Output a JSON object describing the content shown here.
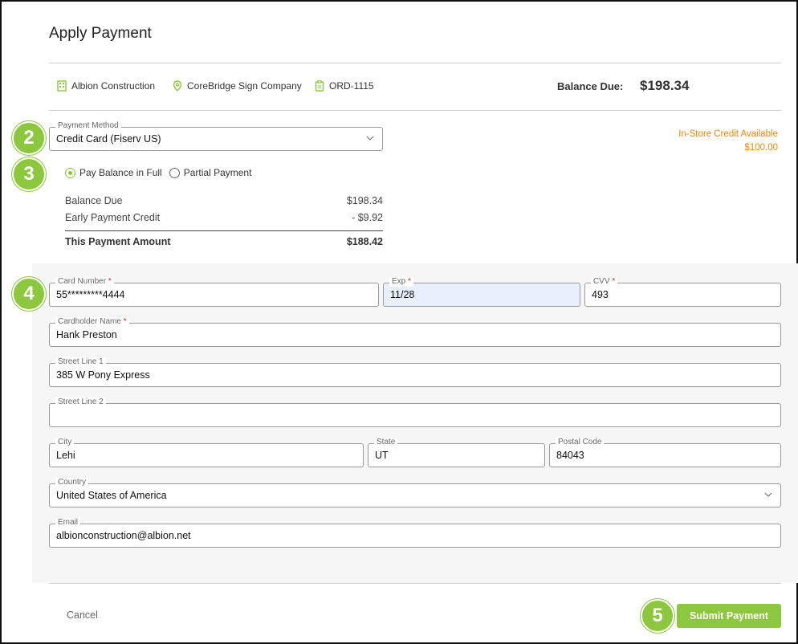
{
  "dialog": {
    "title": "Apply Payment"
  },
  "context": {
    "company": "Albion Construction",
    "location": "CoreBridge Sign Company",
    "order": "ORD-1115",
    "balance_due_label": "Balance Due:",
    "balance_due_value": "$198.34"
  },
  "steps": [
    "2",
    "3",
    "4",
    "5"
  ],
  "payment_method": {
    "label": "Payment Method",
    "value": "Credit Card (Fiserv US)"
  },
  "store_credit": {
    "label": "In-Store Credit Available",
    "amount": "$100.00"
  },
  "payment_options": {
    "full_label": "Pay Balance in Full",
    "partial_label": "Partial Payment",
    "selected": "full"
  },
  "summary": {
    "balance_due_label": "Balance Due",
    "balance_due_value": "$198.34",
    "early_credit_label": "Early Payment Credit",
    "early_credit_value": "- $9.92",
    "total_label": "This Payment Amount",
    "total_value": "$188.42"
  },
  "card": {
    "number_label": "Card Number",
    "number_value": "55*********4444",
    "exp_label": "Exp",
    "exp_value": "11/28",
    "cvv_label": "CVV",
    "cvv_value": "493",
    "holder_label": "Cardholder Name",
    "holder_value": "Hank Preston",
    "street1_label": "Street Line 1",
    "street1_value": "385 W Pony Express",
    "street2_label": "Street Line 2",
    "street2_value": "",
    "city_label": "City",
    "city_value": "Lehi",
    "state_label": "State",
    "state_value": "UT",
    "postal_label": "Postal Code",
    "postal_value": "84043",
    "country_label": "Country",
    "country_value": "United States of America",
    "email_label": "Email",
    "email_value": "albionconstruction@albion.net",
    "required_mark": "*"
  },
  "actions": {
    "cancel_label": "Cancel",
    "submit_label": "Submit Payment"
  },
  "colors": {
    "accent_green": "#8dc63f",
    "credit_orange": "#e8870e",
    "required_red": "#e02020"
  }
}
